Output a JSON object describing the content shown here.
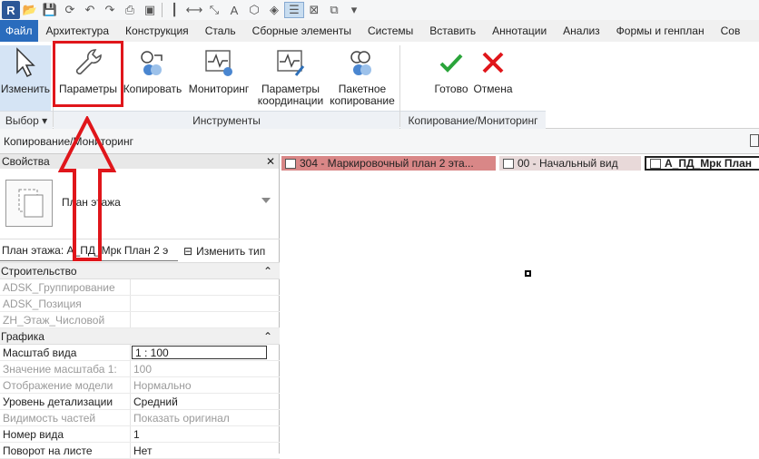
{
  "qat": {
    "logo": "R"
  },
  "tabs": [
    "Файл",
    "Архитектура",
    "Конструкция",
    "Сталь",
    "Сборные элементы",
    "Системы",
    "Вставить",
    "Аннотации",
    "Анализ",
    "Формы и генплан",
    "Сов"
  ],
  "ribbon": {
    "modify": "Изменить",
    "settings": "Параметры",
    "copy": "Копировать",
    "monitor": "Мониторинг",
    "coord_line1": "Параметры",
    "coord_line2": "координации",
    "batch_line1": "Пакетное",
    "batch_line2": "копирование",
    "finish": "Готово",
    "cancel": "Отмена",
    "panel_select": "Выбор ▾",
    "panel_tools": "Инструменты",
    "panel_copymon": "Копирование/Мониторинг"
  },
  "context_bar": "Копирование/Мониторинг",
  "properties": {
    "title": "Свойства",
    "type_name": "План этажа",
    "instance": "План этажа: А_ПД_Мрк План 2 э",
    "edit_type": "Изменить тип",
    "groups": [
      {
        "name": "Строительство"
      },
      {
        "name": "Графика"
      }
    ],
    "rows_construction": [
      {
        "k": "ADSK_Группирование",
        "v": ""
      },
      {
        "k": "ADSK_Позиция",
        "v": ""
      },
      {
        "k": "ZH_Этаж_Числовой",
        "v": ""
      }
    ],
    "rows_graphics": [
      {
        "k": "Масштаб вида",
        "v": "1 : 100"
      },
      {
        "k": "Значение масштаба    1:",
        "v": "100"
      },
      {
        "k": "Отображение модели",
        "v": "Нормально"
      },
      {
        "k": "Уровень детализации",
        "v": "Средний"
      },
      {
        "k": "Видимость частей",
        "v": "Показать оригинал"
      },
      {
        "k": "Номер вида",
        "v": "1"
      },
      {
        "k": "Поворот на листе",
        "v": "Нет"
      }
    ]
  },
  "view_tabs": [
    "304 - Маркировочный план 2 эта...",
    "00 - Начальный вид",
    "А_ПД_Мрк План"
  ],
  "colors": {
    "highlight": "#e0161b",
    "file_tab": "#2a6cbd",
    "finish": "#2aa43a",
    "cancel": "#e0161b"
  }
}
